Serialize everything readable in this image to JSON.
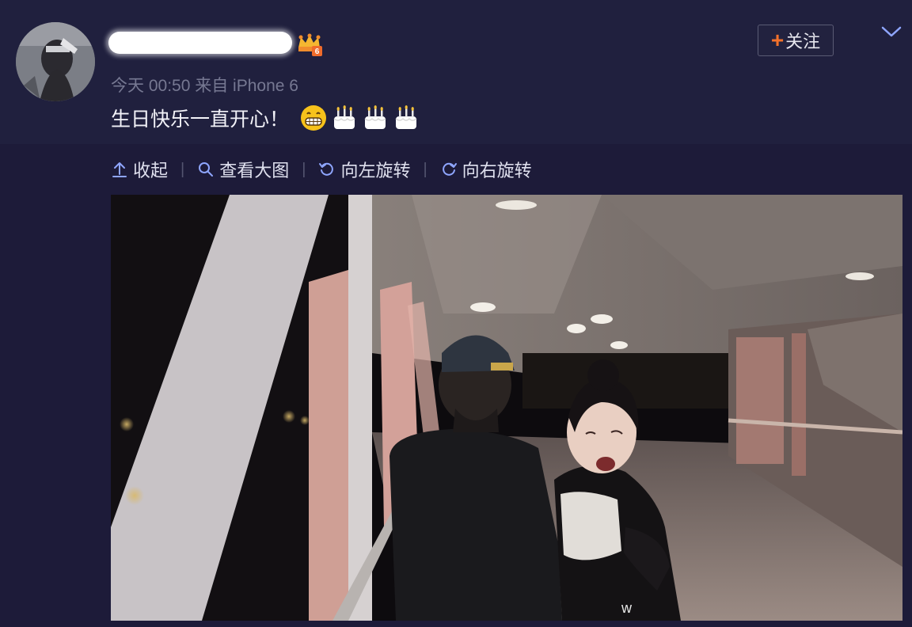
{
  "post": {
    "meta_text": "今天 00:50 来自 iPhone 6",
    "text": "生日快乐一直开心！",
    "emojis": [
      "grinning-face",
      "birthday-cake",
      "birthday-cake",
      "birthday-cake"
    ],
    "follow_plus": "+",
    "follow_label": "关注"
  },
  "toolbar": {
    "collapse_label": "收起",
    "view_large_label": "查看大图",
    "rotate_left_label": "向左旋转",
    "rotate_right_label": "向右旋转",
    "separator": "|"
  },
  "photo": {
    "watermark": "w"
  },
  "colors": {
    "background": "#1d1b39",
    "header": "#20203e",
    "accent_plus": "#f2712b",
    "link_icon": "#8fa6ff",
    "meta_text": "#767892"
  }
}
